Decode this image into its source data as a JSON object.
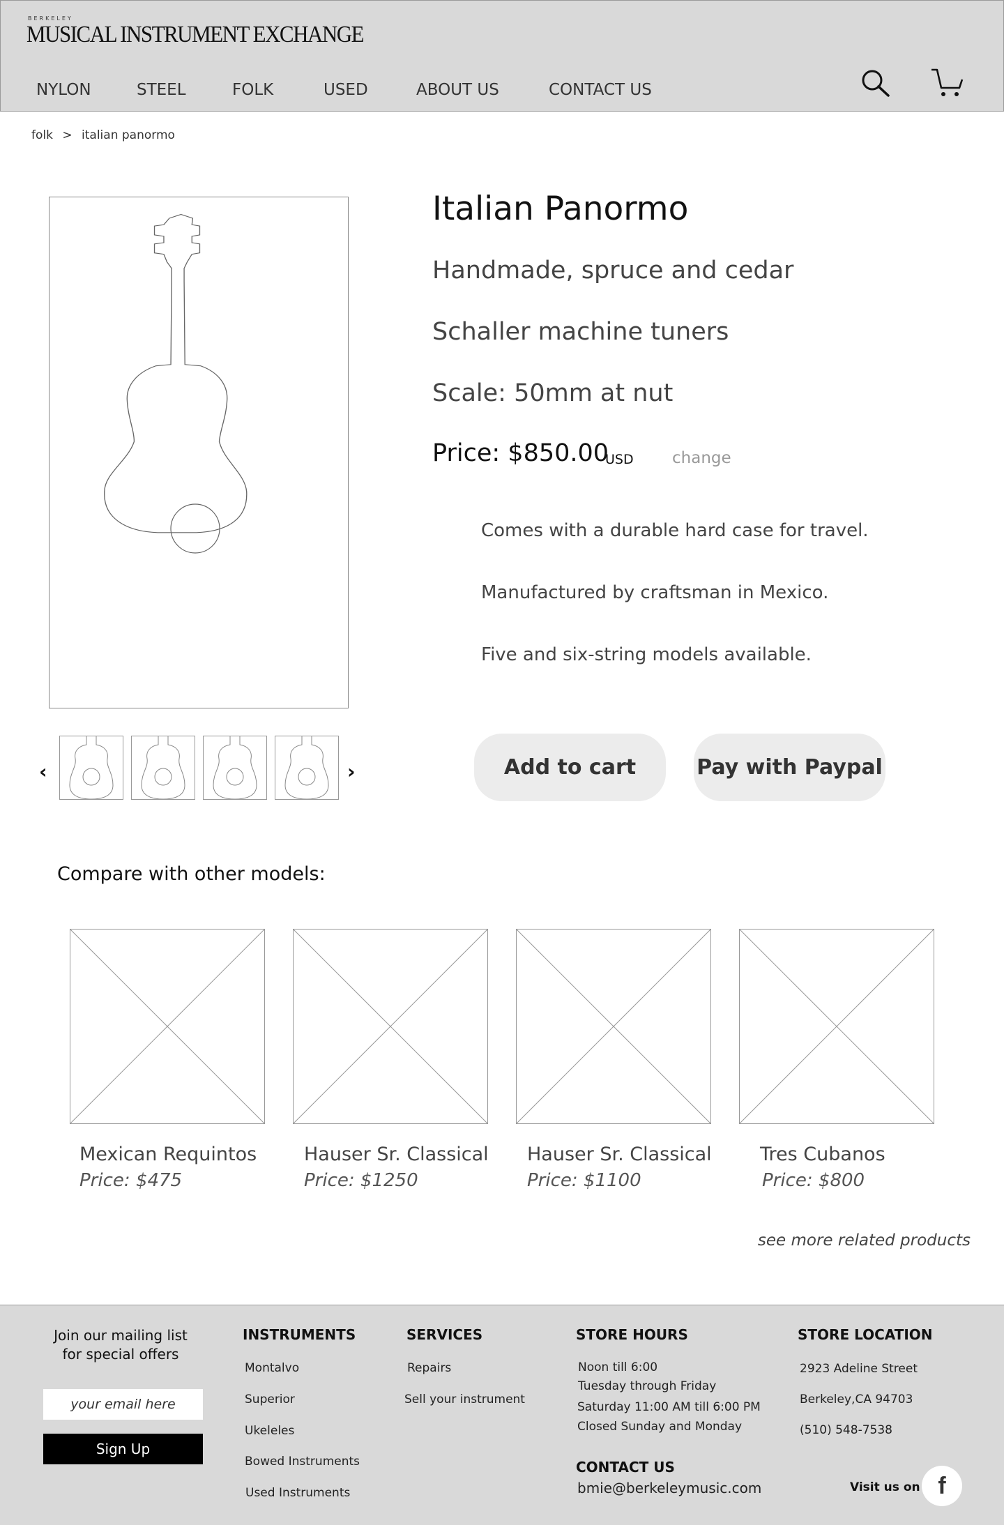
{
  "header": {
    "logo_small": "BERKELEY",
    "logo": "MUSICAL INSTRUMENT EXCHANGE",
    "nav": [
      "NYLON",
      "STEEL",
      "FOLK",
      "USED",
      "ABOUT US",
      "CONTACT US"
    ]
  },
  "breadcrumb": {
    "parent": "folk",
    "separator": ">",
    "current": "italian panormo"
  },
  "product": {
    "title": "Italian Panormo",
    "lines": [
      "Handmade, spruce and cedar",
      "Schaller machine tuners",
      "Scale: 50mm at nut"
    ],
    "price": "Price: $850.00",
    "currency": "USD",
    "change": "change",
    "features": [
      "Comes with a durable hard case for travel.",
      "Manufactured by craftsman in Mexico.",
      "Five and six-string models available."
    ],
    "add_to_cart": "Add to cart",
    "paypal": "Pay with Paypal"
  },
  "compare": {
    "heading": "Compare with other models:",
    "items": [
      {
        "name": "Mexican Requintos",
        "price": "Price: $475"
      },
      {
        "name": "Hauser Sr. Classical",
        "price": "Price: $1250"
      },
      {
        "name": "Hauser Sr. Classical",
        "price": "Price: $1100"
      },
      {
        "name": "Tres Cubanos",
        "price": "Price: $800"
      }
    ],
    "see_more": "see more related products"
  },
  "footer": {
    "join_line1": "Join our mailing list",
    "join_line2": "for special offers",
    "email_placeholder": "your email here",
    "signup": "Sign Up",
    "instruments": {
      "heading": "INSTRUMENTS",
      "links": [
        "Montalvo",
        "Superior",
        "Ukeleles",
        "Bowed Instruments",
        "Used Instruments"
      ]
    },
    "services": {
      "heading": "SERVICES",
      "links": [
        "Repairs",
        "Sell your instrument"
      ]
    },
    "hours": {
      "heading": "STORE HOURS",
      "lines": [
        "Noon till 6:00",
        "Tuesday through Friday",
        "Saturday 11:00 AM  till 6:00 PM",
        "Closed Sunday and Monday"
      ]
    },
    "contact": {
      "heading": "CONTACT US",
      "email": "bmie@berkeleymusic.com"
    },
    "location": {
      "heading": "STORE LOCATION",
      "lines": [
        "2923 Adeline Street",
        "Berkeley,CA 94703",
        "(510) 548-7538"
      ]
    },
    "visit": "Visit us on",
    "facebook_icon": "f"
  }
}
